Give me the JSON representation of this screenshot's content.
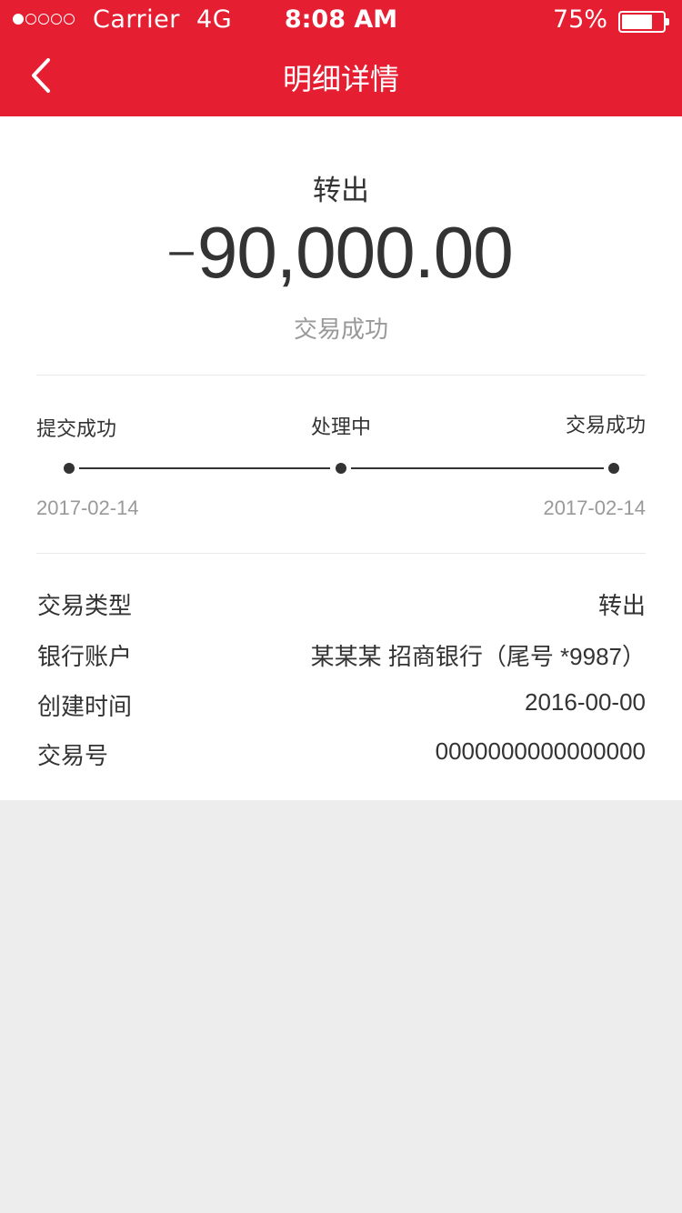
{
  "status_bar": {
    "carrier": "Carrier",
    "network": "4G",
    "time": "8:08 AM",
    "battery_percent": "75%",
    "battery_level": 0.75,
    "signal_bars_on": 1,
    "signal_bars_total": 5
  },
  "nav": {
    "title": "明细详情",
    "back_icon": "chevron-left-icon"
  },
  "transaction": {
    "type_label": "转出",
    "sign": "–",
    "amount": "90,000.00",
    "status": "交易成功"
  },
  "timeline": {
    "steps": [
      {
        "label": "提交成功",
        "date": "2017-02-14"
      },
      {
        "label": "处理中",
        "date": ""
      },
      {
        "label": "交易成功",
        "date": "2017-02-14"
      }
    ]
  },
  "details": [
    {
      "label": "交易类型",
      "value": "转出"
    },
    {
      "label": "银行账户",
      "value": "某某某 招商银行（尾号 *9987）"
    },
    {
      "label": "创建时间",
      "value": "2016-00-00"
    },
    {
      "label": "交易号",
      "value": "0000000000000000"
    }
  ],
  "colors": {
    "brand": "#e61e32",
    "text": "#333333",
    "muted": "#999999",
    "background": "#ededed"
  }
}
